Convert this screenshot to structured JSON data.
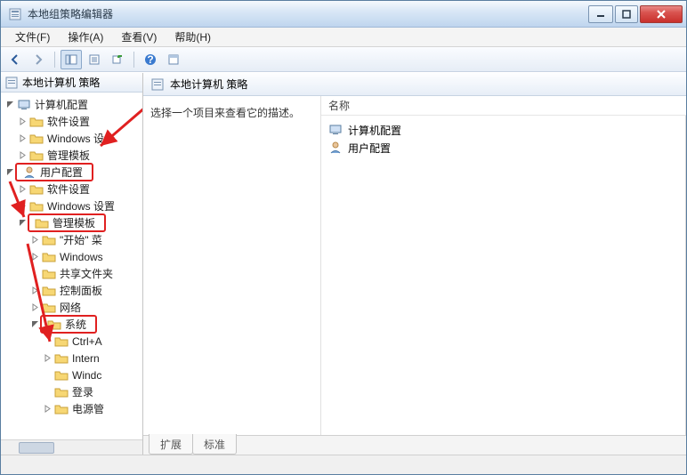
{
  "window": {
    "title": "本地组策略编辑器"
  },
  "menu": {
    "file": "文件(F)",
    "action": "操作(A)",
    "view": "查看(V)",
    "help": "帮助(H)"
  },
  "treebar": {
    "root": "本地计算机 策略"
  },
  "tree": {
    "computer_config": "计算机配置",
    "software_settings": "软件设置",
    "windows_settings_trunc": "Windows 设",
    "admin_templates": "管理模板",
    "user_config": "用户配置",
    "windows_settings2": "Windows 设置",
    "admin_templates2": "管理模板",
    "start_menu": "\"开始\" 菜",
    "windows_comp": "Windows",
    "shared_folders": "共享文件夹",
    "control_panel": "控制面板",
    "network": "网络",
    "system": "系统",
    "ctrl_alt": "Ctrl+A",
    "internet": "Intern",
    "windc": "Windc",
    "logon": "登录",
    "power": "电源管"
  },
  "right": {
    "header": "本地计算机 策略",
    "desc_prompt": "选择一个项目来查看它的描述。",
    "col_name": "名称",
    "items": {
      "computer_config": "计算机配置",
      "user_config": "用户配置"
    }
  },
  "tabs": {
    "extended": "扩展",
    "standard": "标准"
  }
}
